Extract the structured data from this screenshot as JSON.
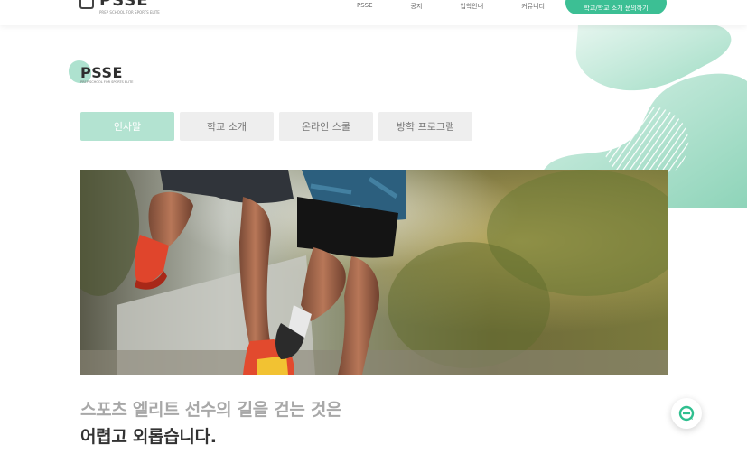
{
  "nav": {
    "logo_word": "PSSE",
    "logo_tag": "PREP SCHOOL FOR SPORTS ELITE",
    "items": [
      "PSSE",
      "공지",
      "입학안내",
      "커뮤니티"
    ],
    "cta_label": "학교/학교 소개 문의하기"
  },
  "brand": {
    "word": "PSSE",
    "tag": "PREP SCHOOL FOR SPORTS ELITE"
  },
  "tabs": [
    {
      "label": "인사말",
      "active": true
    },
    {
      "label": "학교 소개",
      "active": false
    },
    {
      "label": "온라인 스쿨",
      "active": false
    },
    {
      "label": "방학 프로그램",
      "active": false
    }
  ],
  "headline": {
    "line1": "스포츠 엘리트 선수의 길을 걷는 것은",
    "line2": "어렵고 외롭습니다."
  },
  "colors": {
    "accent": "#3cbf94",
    "tab_active": "#b3e3d1",
    "tab_inactive": "#eeeeee"
  },
  "icons": {
    "chat": "chat-bubble-icon"
  }
}
